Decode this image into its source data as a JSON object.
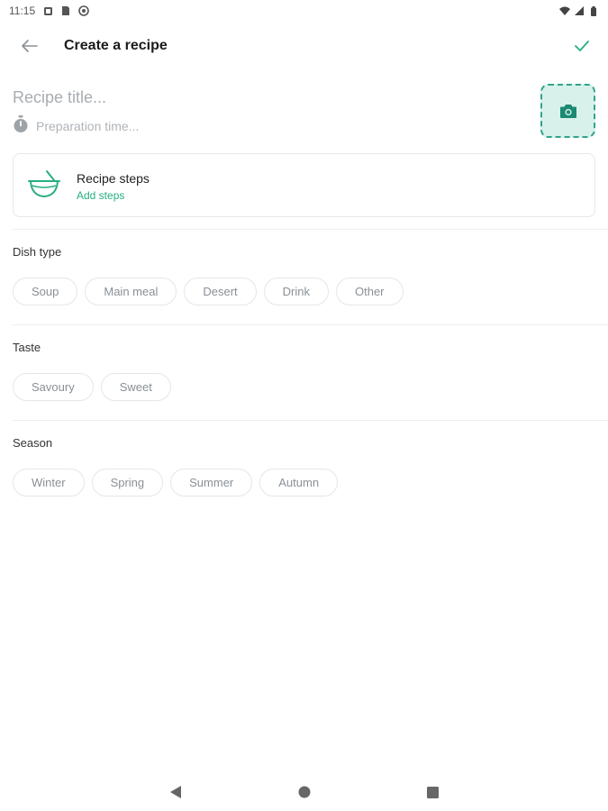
{
  "status_bar": {
    "time": "11:15",
    "icons": [
      "notification-icon",
      "sim-icon",
      "sync-icon"
    ],
    "right_icons": [
      "wifi-icon",
      "signal-icon",
      "battery-icon"
    ]
  },
  "app_bar": {
    "title": "Create a recipe",
    "back_icon": "arrow-left-icon",
    "confirm_icon": "check-icon"
  },
  "form": {
    "title_placeholder": "Recipe title...",
    "prep_placeholder": "Preparation time...",
    "prep_icon": "stopwatch-icon",
    "photo_icon": "camera-icon"
  },
  "steps_card": {
    "title": "Recipe steps",
    "subtitle": "Add steps",
    "icon": "bowl-icon"
  },
  "sections": {
    "dish_type": {
      "label": "Dish type",
      "chips": [
        "Soup",
        "Main meal",
        "Desert",
        "Drink",
        "Other"
      ]
    },
    "taste": {
      "label": "Taste",
      "chips": [
        "Savoury",
        "Sweet"
      ]
    },
    "season": {
      "label": "Season",
      "chips": [
        "Winter",
        "Spring",
        "Summer",
        "Autumn"
      ]
    }
  },
  "colors": {
    "accent": "#27ae82",
    "photo_bg": "#d9f1eb",
    "chip_text": "#8a9096"
  },
  "nav_bar": {
    "icons": [
      "back-triangle-icon",
      "home-circle-icon",
      "recents-square-icon"
    ]
  }
}
